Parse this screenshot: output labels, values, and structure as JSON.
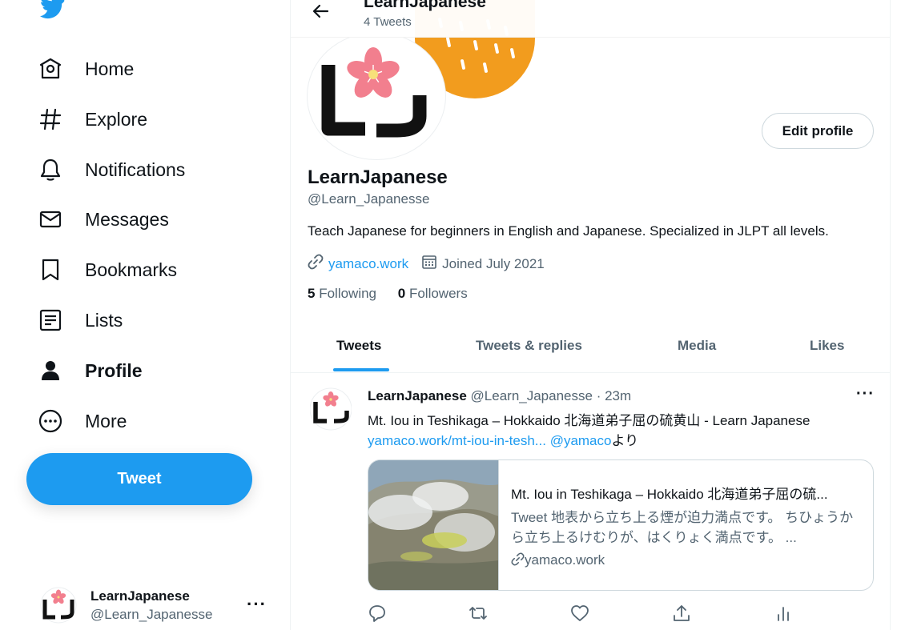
{
  "nav": {
    "items": [
      {
        "label": "Home",
        "icon": "home-icon"
      },
      {
        "label": "Explore",
        "icon": "hashtag-icon"
      },
      {
        "label": "Notifications",
        "icon": "bell-icon"
      },
      {
        "label": "Messages",
        "icon": "envelope-icon"
      },
      {
        "label": "Bookmarks",
        "icon": "bookmark-icon"
      },
      {
        "label": "Lists",
        "icon": "list-icon"
      },
      {
        "label": "Profile",
        "icon": "person-icon",
        "active": true
      },
      {
        "label": "More",
        "icon": "more-circle-icon"
      }
    ],
    "tweet_button": "Tweet"
  },
  "account": {
    "name": "LearnJapanese",
    "handle": "@Learn_Japanesse",
    "more": "···"
  },
  "header": {
    "title": "LearnJapanese",
    "subtitle": "4 Tweets"
  },
  "profile": {
    "edit_button": "Edit profile",
    "name": "LearnJapanese",
    "handle": "@Learn_Japanesse",
    "bio": "Teach Japanese for beginners in English and Japanese. Specialized in JLPT all levels.",
    "website": "yamaco.work",
    "joined": "Joined July 2021",
    "following_count": "5",
    "following_label": "Following",
    "followers_count": "0",
    "followers_label": "Followers",
    "avatar_text": "LJ"
  },
  "tabs": [
    {
      "label": "Tweets",
      "active": true
    },
    {
      "label": "Tweets & replies"
    },
    {
      "label": "Media"
    },
    {
      "label": "Likes"
    }
  ],
  "tweet": {
    "author": "LearnJapanese",
    "handle": "@Learn_Japanesse",
    "time": "· 23m",
    "more": "···",
    "text_line1": "Mt. Iou in Teshikaga – Hokkaido 北海道弟子屈の硫黄山 - Learn Japanese",
    "link": "yamaco.work/mt-iou-in-tesh...",
    "mention": "@yamaco",
    "suffix": "より",
    "card": {
      "title": "Mt. Iou in Teshikaga – Hokkaido 北海道弟子屈の硫...",
      "description": "Tweet 地表から立ち上る煙が迫力満点です。 ちひょうから立ち上るけむりが、はくりょく満点です。 ...",
      "domain": "yamaco.work"
    }
  },
  "colors": {
    "accent": "#1d9bf0",
    "banner": "#f29c1e",
    "sakura": "#f27f8e"
  }
}
